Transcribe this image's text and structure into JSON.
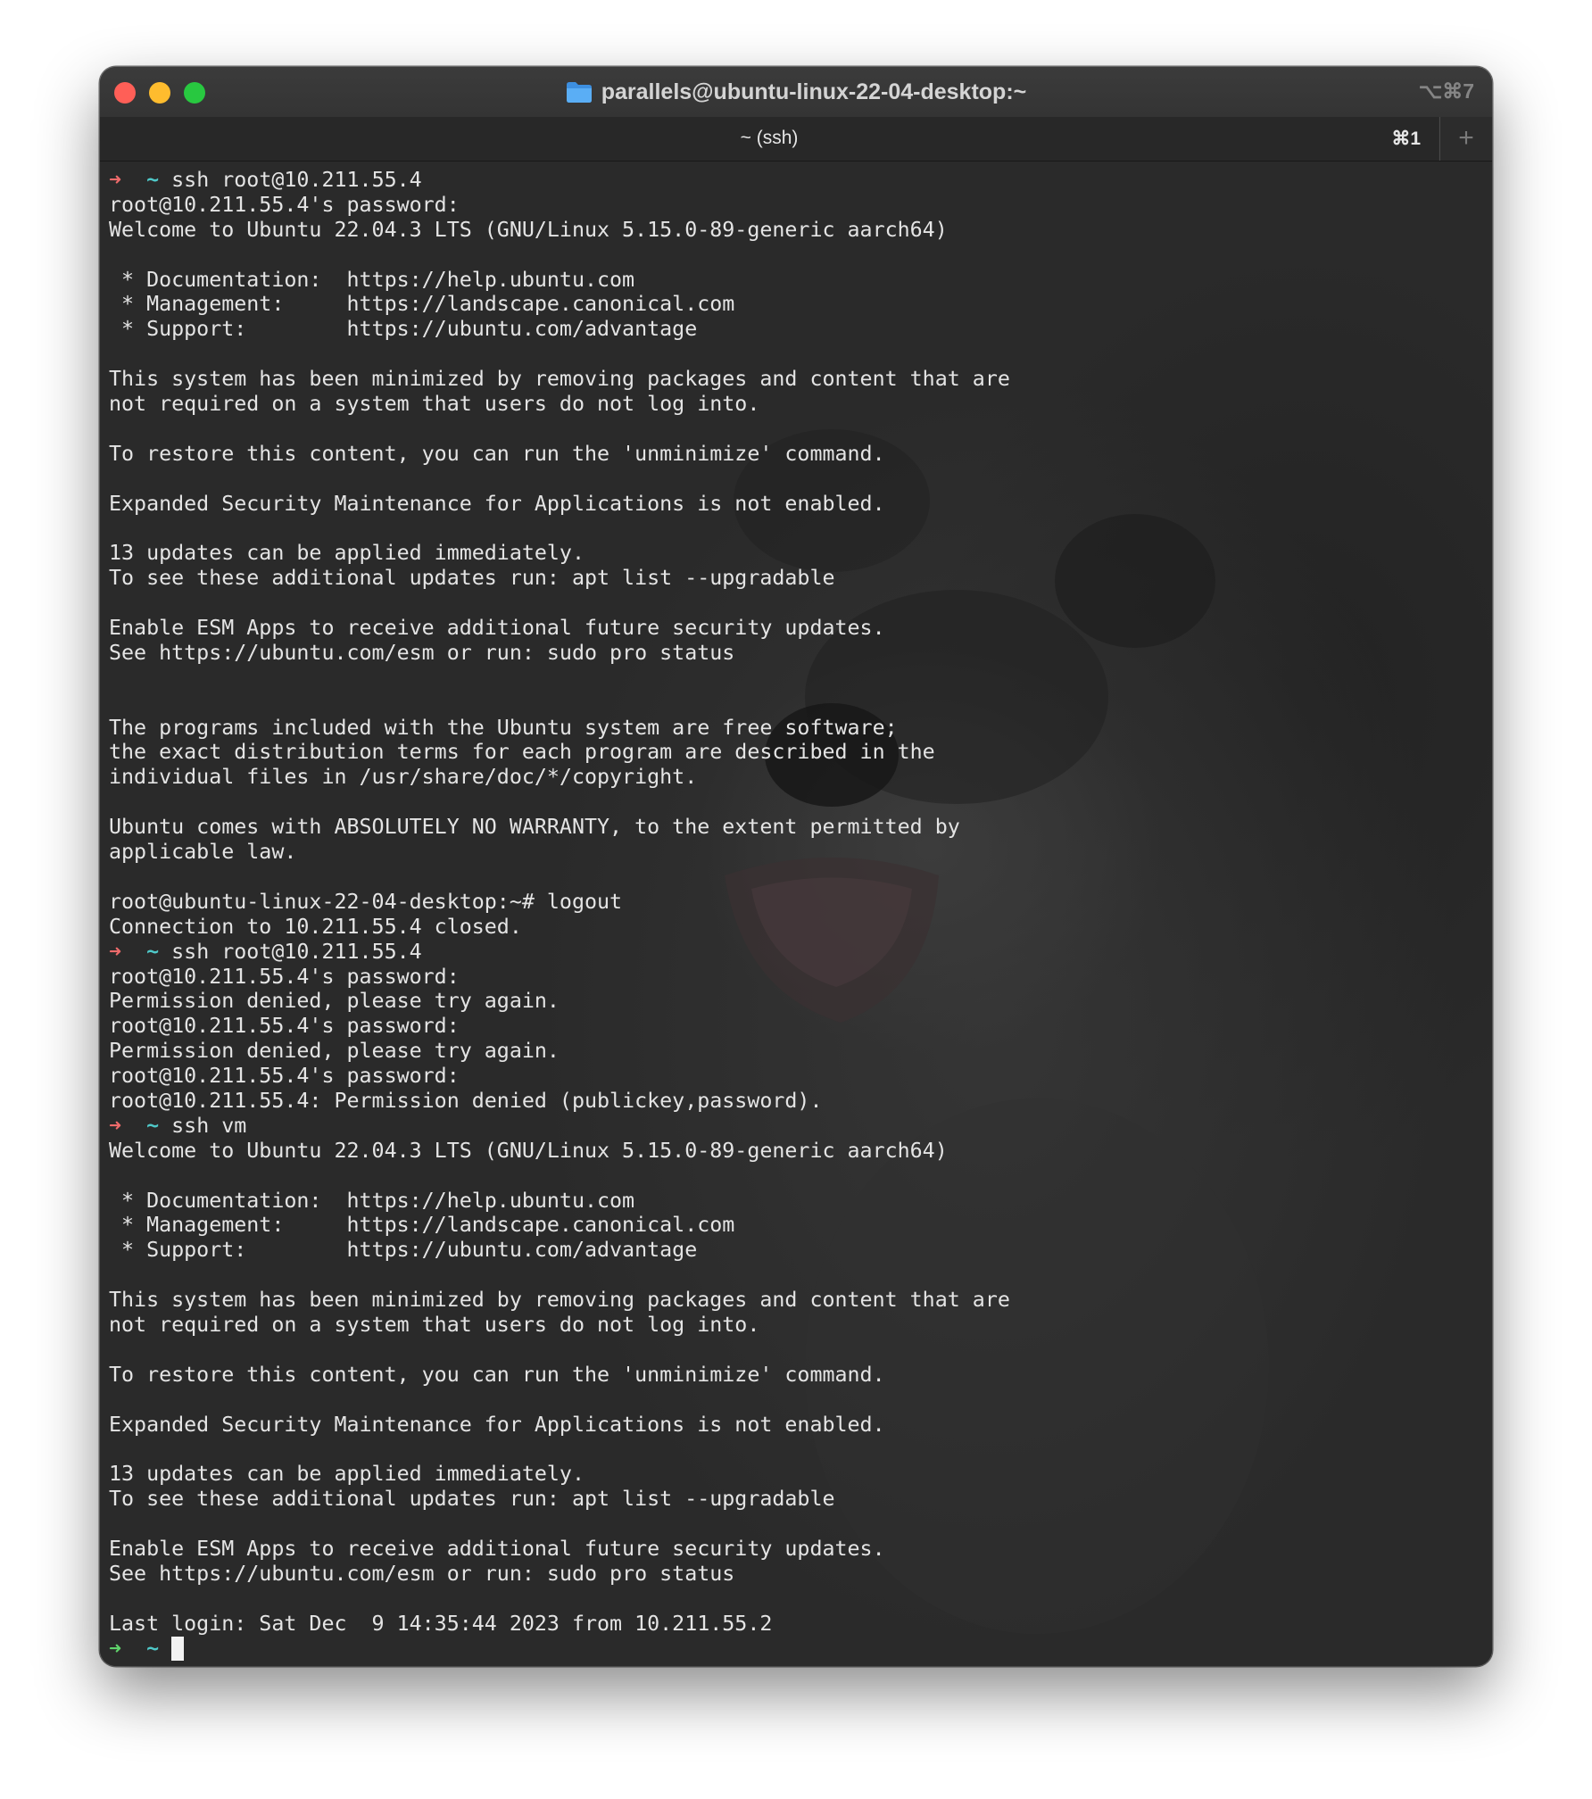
{
  "window": {
    "title": "parallels@ubuntu-linux-22-04-desktop:~",
    "shortcut_hint": "⌥⌘7"
  },
  "tabs": [
    {
      "label": "~ (ssh)",
      "shortcut": "⌘1",
      "active": true
    }
  ],
  "new_tab_label": "+",
  "prompt": {
    "arrow": "➜",
    "directory": "~"
  },
  "terminal_lines": [
    {
      "prompt": "fail",
      "text": "ssh root@10.211.55.4"
    },
    {
      "text": "root@10.211.55.4's password:"
    },
    {
      "text": "Welcome to Ubuntu 22.04.3 LTS (GNU/Linux 5.15.0-89-generic aarch64)"
    },
    {
      "text": ""
    },
    {
      "text": " * Documentation:  https://help.ubuntu.com"
    },
    {
      "text": " * Management:     https://landscape.canonical.com"
    },
    {
      "text": " * Support:        https://ubuntu.com/advantage"
    },
    {
      "text": ""
    },
    {
      "text": "This system has been minimized by removing packages and content that are"
    },
    {
      "text": "not required on a system that users do not log into."
    },
    {
      "text": ""
    },
    {
      "text": "To restore this content, you can run the 'unminimize' command."
    },
    {
      "text": ""
    },
    {
      "text": "Expanded Security Maintenance for Applications is not enabled."
    },
    {
      "text": ""
    },
    {
      "text": "13 updates can be applied immediately."
    },
    {
      "text": "To see these additional updates run: apt list --upgradable"
    },
    {
      "text": ""
    },
    {
      "text": "Enable ESM Apps to receive additional future security updates."
    },
    {
      "text": "See https://ubuntu.com/esm or run: sudo pro status"
    },
    {
      "text": ""
    },
    {
      "text": ""
    },
    {
      "text": "The programs included with the Ubuntu system are free software;"
    },
    {
      "text": "the exact distribution terms for each program are described in the"
    },
    {
      "text": "individual files in /usr/share/doc/*/copyright."
    },
    {
      "text": ""
    },
    {
      "text": "Ubuntu comes with ABSOLUTELY NO WARRANTY, to the extent permitted by"
    },
    {
      "text": "applicable law."
    },
    {
      "text": ""
    },
    {
      "text": "root@ubuntu-linux-22-04-desktop:~# logout"
    },
    {
      "text": "Connection to 10.211.55.4 closed."
    },
    {
      "prompt": "fail",
      "text": "ssh root@10.211.55.4"
    },
    {
      "text": "root@10.211.55.4's password:"
    },
    {
      "text": "Permission denied, please try again."
    },
    {
      "text": "root@10.211.55.4's password:"
    },
    {
      "text": "Permission denied, please try again."
    },
    {
      "text": "root@10.211.55.4's password:"
    },
    {
      "text": "root@10.211.55.4: Permission denied (publickey,password)."
    },
    {
      "prompt": "fail",
      "text": "ssh vm"
    },
    {
      "text": "Welcome to Ubuntu 22.04.3 LTS (GNU/Linux 5.15.0-89-generic aarch64)"
    },
    {
      "text": ""
    },
    {
      "text": " * Documentation:  https://help.ubuntu.com"
    },
    {
      "text": " * Management:     https://landscape.canonical.com"
    },
    {
      "text": " * Support:        https://ubuntu.com/advantage"
    },
    {
      "text": ""
    },
    {
      "text": "This system has been minimized by removing packages and content that are"
    },
    {
      "text": "not required on a system that users do not log into."
    },
    {
      "text": ""
    },
    {
      "text": "To restore this content, you can run the 'unminimize' command."
    },
    {
      "text": ""
    },
    {
      "text": "Expanded Security Maintenance for Applications is not enabled."
    },
    {
      "text": ""
    },
    {
      "text": "13 updates can be applied immediately."
    },
    {
      "text": "To see these additional updates run: apt list --upgradable"
    },
    {
      "text": ""
    },
    {
      "text": "Enable ESM Apps to receive additional future security updates."
    },
    {
      "text": "See https://ubuntu.com/esm or run: sudo pro status"
    },
    {
      "text": ""
    },
    {
      "text": "Last login: Sat Dec  9 14:35:44 2023 from 10.211.55.2"
    },
    {
      "prompt": "ok",
      "text": "",
      "cursor": true
    }
  ],
  "colors": {
    "prompt_fail_arrow": "#ee6b6b",
    "prompt_ok_arrow": "#5fd36b",
    "prompt_directory": "#4fc8c8",
    "terminal_text": "#e4e4e4",
    "terminal_background": "#2a2a2a",
    "close_button": "#ff5f57",
    "minimize_button": "#febc2e",
    "zoom_button": "#28c840",
    "folder_icon": "#4aa3f0"
  }
}
